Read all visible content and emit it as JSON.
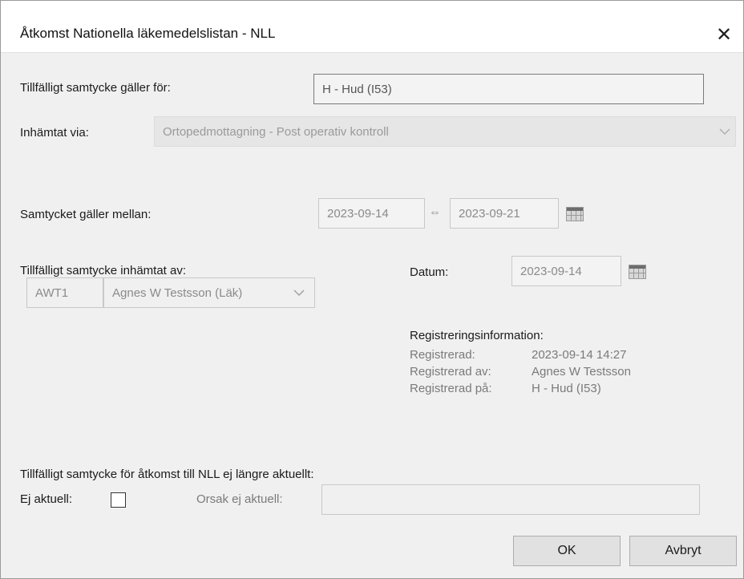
{
  "window": {
    "title": "Åtkomst Nationella läkemedelslistan - NLL",
    "close_symbol": "✕"
  },
  "consent_for": {
    "label": "Tillfälligt samtycke gäller för:",
    "value": "H - Hud (I53)"
  },
  "obtained_via": {
    "label": "Inhämtat via:",
    "value": "Ortopedmottagning - Post operativ kontroll"
  },
  "valid_between": {
    "label": "Samtycket gäller mellan:",
    "from": "2023-09-14",
    "arrow": "⇔",
    "to": "2023-09-21"
  },
  "obtained_by": {
    "label": "Tillfälligt samtycke inhämtat av:",
    "code": "AWT1",
    "name": "Agnes W Testsson (Läk)"
  },
  "date": {
    "label": "Datum:",
    "value": "2023-09-14"
  },
  "registration": {
    "heading": "Registreringsinformation:",
    "rows": [
      {
        "key": "Registrerad:",
        "value": "2023-09-14 14:27"
      },
      {
        "key": "Registrerad av:",
        "value": "Agnes W Testsson"
      },
      {
        "key": "Registrerad på:",
        "value": "H - Hud (I53)"
      }
    ]
  },
  "not_current": {
    "heading": "Tillfälligt samtycke för åtkomst till NLL ej längre aktuellt:",
    "checkbox_label": "Ej aktuell:",
    "checked": false,
    "reason_label": "Orsak ej aktuell:",
    "reason_value": ""
  },
  "buttons": {
    "ok": "OK",
    "cancel": "Avbryt"
  },
  "icons": [
    "close-icon",
    "calendar-icon",
    "chevron-down-icon",
    "double-arrow-icon"
  ]
}
